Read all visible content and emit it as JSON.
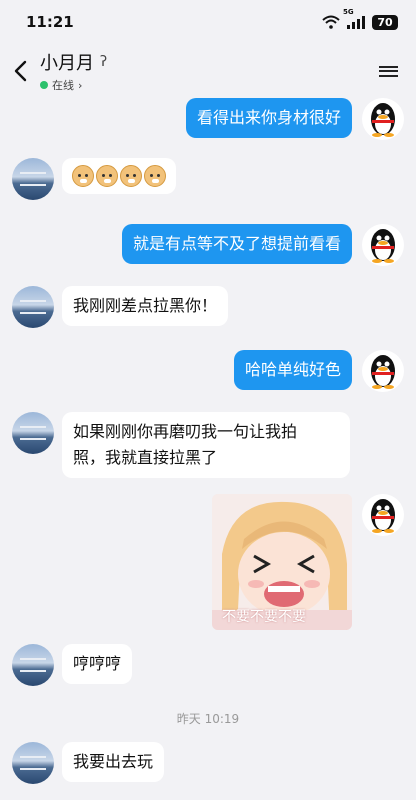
{
  "status_bar": {
    "time": "11:21",
    "network": "5G",
    "battery": "70"
  },
  "header": {
    "title": "小月月",
    "status": "在线"
  },
  "messages": [
    {
      "side": "right",
      "text": "看得出来你身材很好"
    },
    {
      "side": "left",
      "type": "emoji",
      "emoji_count": 4,
      "emoji": "doge-icon"
    },
    {
      "side": "right",
      "text": "就是有点等不及了想提前看看"
    },
    {
      "side": "left",
      "text": "我刚刚差点拉黑你！"
    },
    {
      "side": "right",
      "text": "哈哈单纯好色"
    },
    {
      "side": "left",
      "text": "如果刚刚你再磨叨我一句让我拍\n照，我就直接拉黑了"
    },
    {
      "side": "right",
      "type": "sticker",
      "caption": "不要不要不要"
    },
    {
      "side": "left",
      "text": "哼哼哼"
    },
    {
      "side": "left",
      "text": "我要出去玩"
    }
  ],
  "timestamp": "昨天 10:19",
  "colors": {
    "sent_bubble": "#1e96f0",
    "received_bubble": "#ffffff",
    "background": "#f2f2f5",
    "online": "#2cc16c"
  }
}
